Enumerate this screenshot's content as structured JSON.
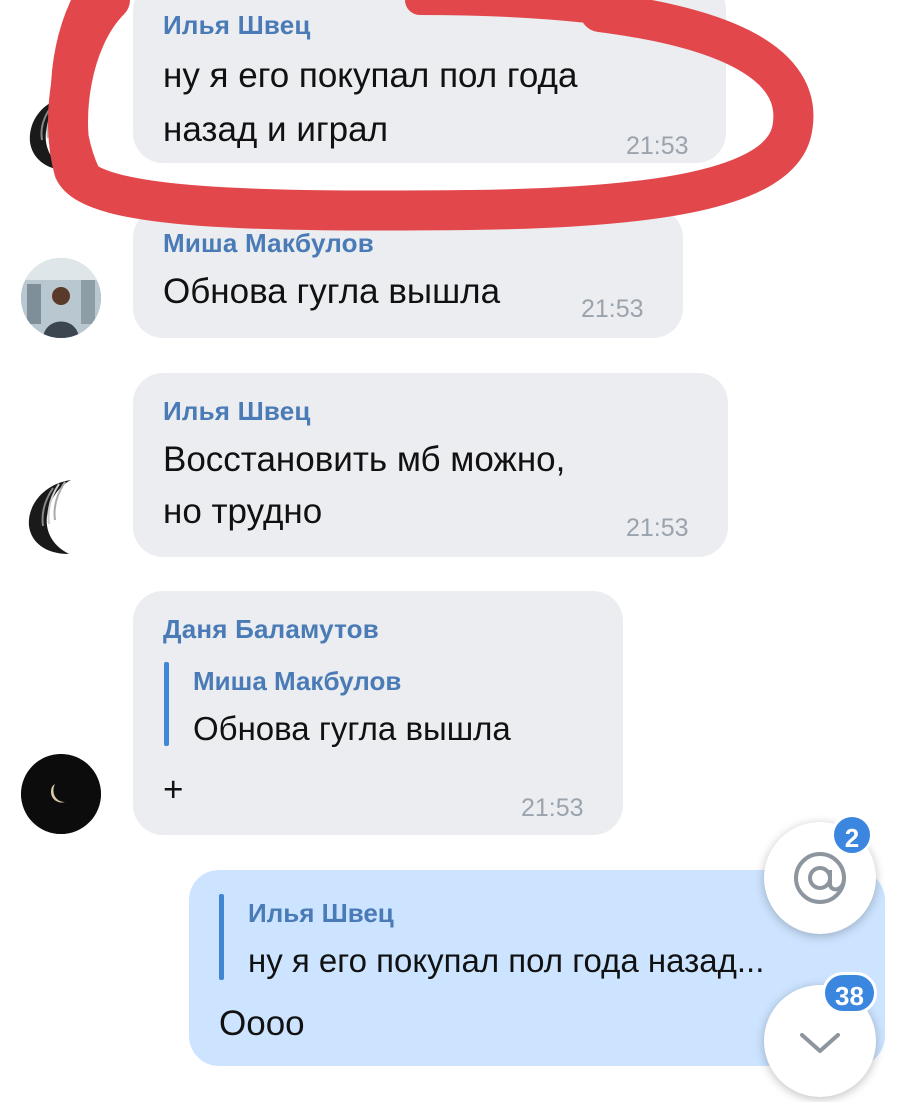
{
  "messages": [
    {
      "sender": "Илья Швец",
      "lines": [
        "ну я его покупал пол года",
        "назад и играл"
      ],
      "time": "21:53"
    },
    {
      "sender": "Миша Макбулов",
      "lines": [
        "Обнова гугла вышла"
      ],
      "time": "21:53"
    },
    {
      "sender": "Илья Швец",
      "lines": [
        "Восстановить мб можно,",
        "но трудно"
      ],
      "time": "21:53"
    },
    {
      "sender": "Даня Баламутов",
      "reply": {
        "name": "Миша Макбулов",
        "text": "Обнова гугла вышла"
      },
      "lines": [
        "+"
      ],
      "time": "21:53"
    },
    {
      "reply": {
        "name": "Илья Швец",
        "text": "ну я его покупал пол года назад..."
      },
      "lines": [
        "Оооо"
      ]
    }
  ],
  "mentions_badge": "2",
  "unread_badge": "38",
  "icons": {
    "mention": "at-icon",
    "scroll_down": "chevron-down-icon"
  },
  "colors": {
    "incoming_bubble": "#ebedf0",
    "outgoing_bubble": "#cce4ff",
    "name": "#4a7bb6",
    "highlight": "#e2474b"
  }
}
